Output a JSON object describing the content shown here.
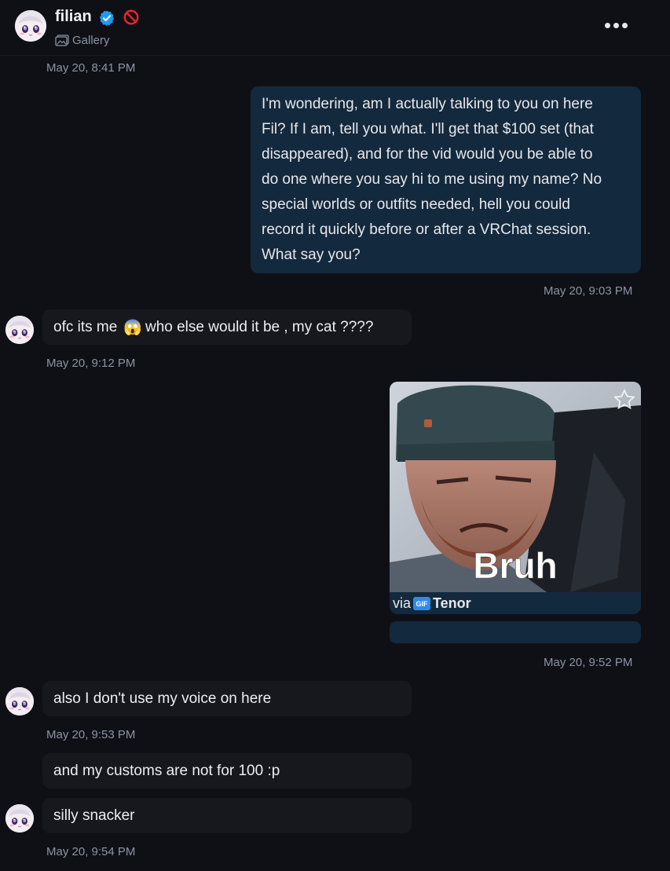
{
  "header": {
    "name": "filian",
    "gallery_label": "Gallery"
  },
  "messages": [
    {
      "kind": "timestamp",
      "text": "May 20, 8:41 PM"
    },
    {
      "kind": "outgoing",
      "text": "I'm wondering, am I actually talking to you on here Fil? If I am, tell you what. I'll get that $100 set (that disappeared), and for the vid would you be able to do one where you say hi to me using my name? No special worlds or outfits needed, hell you could record it quickly before or after a VRChat session. What say you?",
      "lines": [
        "I'm wondering, am I actually talking to you on here",
        "Fil? If I am, tell you what. I'll get that $100 set (that",
        "disappeared), and for the vid would you be able to",
        "do one where you say hi to me using my name? No",
        "special worlds or outfits needed, hell you could",
        "record it quickly before or after a VRChat session.",
        "What say you?"
      ]
    },
    {
      "kind": "timestamp",
      "text": "May 20, 9:03 PM"
    },
    {
      "kind": "incoming",
      "text_before": "ofc its me",
      "emoji": "😱",
      "text_after": "who else would it be , my cat ????"
    },
    {
      "kind": "timestamp",
      "text": "May 20, 9:12 PM"
    },
    {
      "kind": "gif",
      "caption": "Bruh",
      "via": "via",
      "badge": "GIF",
      "source": "Tenor"
    },
    {
      "kind": "timestamp",
      "text": "May 20, 9:52 PM"
    },
    {
      "kind": "incoming",
      "text": "also I don't use my voice on here"
    },
    {
      "kind": "timestamp",
      "text": "May 20, 9:53 PM"
    },
    {
      "kind": "incoming",
      "text": "and my customs are not for 100 :p"
    },
    {
      "kind": "incoming",
      "text": "silly snacker"
    },
    {
      "kind": "timestamp",
      "text": "May 20, 9:54 PM"
    }
  ]
}
